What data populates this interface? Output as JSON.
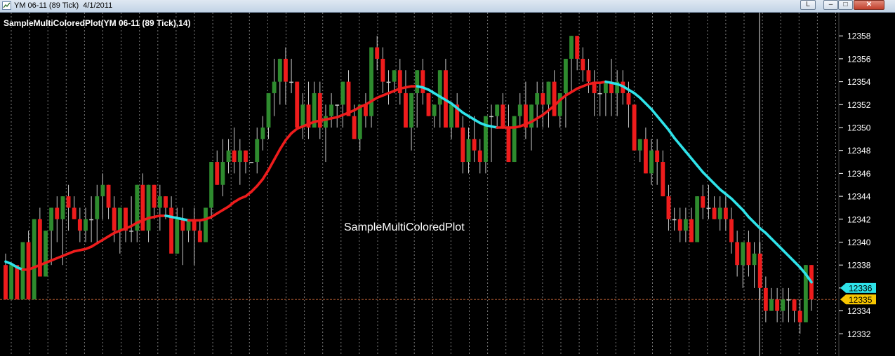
{
  "window": {
    "title": "YM 06-11 (89 Tick)  4/1/2011",
    "lock_label": "L",
    "minimize_label": "–",
    "maximize_label": "□",
    "close_label": "✕"
  },
  "chart_data": {
    "type": "candlestick",
    "instrument": "YM 06-11 (89 Tick)",
    "indicator_label": "SampleMultiColoredPlot(YM 06-11 (89 Tick),14)",
    "watermark": "SampleMultiColoredPlot",
    "y_ticks": [
      12332,
      12334,
      12336,
      12338,
      12340,
      12342,
      12344,
      12346,
      12348,
      12350,
      12352,
      12354,
      12356,
      12358
    ],
    "ylim": [
      12331,
      12359.5
    ],
    "grid": "vertical dotted",
    "last_price": 12335,
    "last_price_label": "12335",
    "indicator_value": 12336,
    "indicator_value_label": "12336",
    "colors": {
      "background": "#000000",
      "up": "#2e8b2e",
      "down": "#ee1c1c",
      "wick": "#c8c8c8",
      "rising_plot": "#ee1c1c",
      "falling_plot": "#2fe3ea",
      "price_marker": "#f7c600",
      "indicator_marker": "#2fe3ea",
      "last_price_line": "#a0522d"
    },
    "bars": [
      [
        12338,
        12339,
        12335,
        12335
      ],
      [
        12335,
        12338,
        12335,
        12338
      ],
      [
        12338,
        12338,
        12335,
        12335
      ],
      [
        12335,
        12340,
        12335,
        12340
      ],
      [
        12340,
        12341,
        12335,
        12335
      ],
      [
        12335,
        12342,
        12335,
        12342
      ],
      [
        12342,
        12343,
        12337,
        12337
      ],
      [
        12337,
        12341,
        12337,
        12341
      ],
      [
        12341,
        12343,
        12338,
        12343
      ],
      [
        12343,
        12344,
        12340,
        12342
      ],
      [
        12342,
        12344,
        12338,
        12344
      ],
      [
        12344,
        12345,
        12341,
        12343
      ],
      [
        12343,
        12344,
        12342,
        12342
      ],
      [
        12342,
        12343,
        12340,
        12341
      ],
      [
        12341,
        12343,
        12340,
        12342
      ],
      [
        12342,
        12344,
        12340,
        12342
      ],
      [
        12342,
        12345,
        12340,
        12344
      ],
      [
        12344,
        12346,
        12342,
        12345
      ],
      [
        12345,
        12345,
        12342,
        12343
      ],
      [
        12343,
        12344,
        12340,
        12341
      ],
      [
        12341,
        12343,
        12339,
        12343
      ],
      [
        12343,
        12343,
        12340,
        12341
      ],
      [
        12341,
        12344,
        12340,
        12341
      ],
      [
        12341,
        12345,
        12340,
        12345
      ],
      [
        12345,
        12346,
        12342,
        12341
      ],
      [
        12341,
        12345,
        12340,
        12345
      ],
      [
        12345,
        12345,
        12342,
        12343
      ],
      [
        12343,
        12345,
        12341,
        12344
      ],
      [
        12344,
        12344,
        12342,
        12343
      ],
      [
        12343,
        12344,
        12340,
        12339
      ],
      [
        12339,
        12343,
        12339,
        12342
      ],
      [
        12342,
        12343,
        12338,
        12341
      ],
      [
        12341,
        12342,
        12340,
        12342
      ],
      [
        12342,
        12343,
        12338,
        12341
      ],
      [
        12341,
        12342,
        12340,
        12340
      ],
      [
        12340,
        12343,
        12340,
        12343
      ],
      [
        12343,
        12347,
        12342,
        12347
      ],
      [
        12347,
        12348,
        12345,
        12345
      ],
      [
        12345,
        12349,
        12344,
        12347
      ],
      [
        12347,
        12349,
        12346,
        12348
      ],
      [
        12348,
        12350,
        12346,
        12347
      ],
      [
        12347,
        12349,
        12345,
        12348
      ],
      [
        12348,
        12348,
        12346,
        12347
      ],
      [
        12347,
        12347,
        12347,
        12347
      ],
      [
        12347,
        12350,
        12346,
        12349
      ],
      [
        12349,
        12351,
        12348,
        12350
      ],
      [
        12350,
        12352,
        12349,
        12353
      ],
      [
        12353,
        12356,
        12351,
        12354
      ],
      [
        12354,
        12356,
        12352,
        12356
      ],
      [
        12356,
        12357,
        12352,
        12354
      ],
      [
        12354,
        12356,
        12353,
        12354
      ],
      [
        12354,
        12354,
        12351,
        12350
      ],
      [
        12350,
        12353,
        12349,
        12352
      ],
      [
        12352,
        12354,
        12349,
        12350
      ],
      [
        12350,
        12354,
        12350,
        12353
      ],
      [
        12353,
        12354,
        12349,
        12350
      ],
      [
        12350,
        12352,
        12347,
        12351
      ],
      [
        12351,
        12353,
        12350,
        12352
      ],
      [
        12352,
        12352,
        12350,
        12352
      ],
      [
        12352,
        12354,
        12350,
        12354
      ],
      [
        12354,
        12355,
        12352,
        12351
      ],
      [
        12351,
        12352,
        12350,
        12349
      ],
      [
        12349,
        12352,
        12348,
        12352
      ],
      [
        12352,
        12353,
        12350,
        12351
      ],
      [
        12351,
        12357,
        12350,
        12357
      ],
      [
        12357,
        12358,
        12355,
        12356
      ],
      [
        12356,
        12357,
        12353,
        12354
      ],
      [
        12354,
        12355,
        12352,
        12354
      ],
      [
        12354,
        12355,
        12353,
        12355
      ],
      [
        12355,
        12356,
        12352,
        12353
      ],
      [
        12353,
        12355,
        12350,
        12350
      ],
      [
        12350,
        12353,
        12348,
        12353
      ],
      [
        12353,
        12355,
        12350,
        12355
      ],
      [
        12355,
        12356,
        12352,
        12353
      ],
      [
        12353,
        12353,
        12351,
        12351
      ],
      [
        12351,
        12352,
        12350,
        12352
      ],
      [
        12352,
        12355,
        12350,
        12355
      ],
      [
        12355,
        12356,
        12350,
        12350
      ],
      [
        12350,
        12352,
        12349,
        12352
      ],
      [
        12352,
        12353,
        12350,
        12350
      ],
      [
        12350,
        12351,
        12346,
        12347
      ],
      [
        12347,
        12350,
        12346,
        12349
      ],
      [
        12349,
        12351,
        12347,
        12348
      ],
      [
        12348,
        12349,
        12346,
        12347
      ],
      [
        12347,
        12350,
        12346,
        12351
      ],
      [
        12351,
        12352,
        12347,
        12351
      ],
      [
        12351,
        12352,
        12350,
        12352
      ],
      [
        12352,
        12353,
        12350,
        12350
      ],
      [
        12350,
        12352,
        12347,
        12347
      ],
      [
        12347,
        12351,
        12347,
        12351
      ],
      [
        12351,
        12353,
        12350,
        12352
      ],
      [
        12352,
        12354,
        12349,
        12350
      ],
      [
        12350,
        12352,
        12348,
        12352
      ],
      [
        12352,
        12354,
        12350,
        12353
      ],
      [
        12353,
        12354,
        12350,
        12352
      ],
      [
        12352,
        12354,
        12350,
        12354
      ],
      [
        12354,
        12355,
        12351,
        12351
      ],
      [
        12351,
        12353,
        12350,
        12353
      ],
      [
        12353,
        12354,
        12350,
        12356
      ],
      [
        12356,
        12358,
        12353,
        12358
      ],
      [
        12358,
        12358,
        12355,
        12356
      ],
      [
        12356,
        12357,
        12354,
        12355
      ],
      [
        12355,
        12356,
        12353,
        12354
      ],
      [
        12354,
        12355,
        12351,
        12353
      ],
      [
        12353,
        12354,
        12351,
        12353
      ],
      [
        12353,
        12354,
        12351,
        12354
      ],
      [
        12354,
        12356,
        12351,
        12353
      ],
      [
        12353,
        12355,
        12351,
        12354
      ],
      [
        12354,
        12355,
        12352,
        12353
      ],
      [
        12353,
        12354,
        12350,
        12352
      ],
      [
        12352,
        12352,
        12348,
        12348
      ],
      [
        12348,
        12349,
        12347,
        12349
      ],
      [
        12349,
        12350,
        12346,
        12346
      ],
      [
        12346,
        12349,
        12345,
        12348
      ],
      [
        12348,
        12349,
        12345,
        12347
      ],
      [
        12347,
        12348,
        12344,
        12344
      ],
      [
        12344,
        12345,
        12341,
        12342
      ],
      [
        12342,
        12343,
        12341,
        12342
      ],
      [
        12342,
        12343,
        12340,
        12341
      ],
      [
        12341,
        12343,
        12340,
        12342
      ],
      [
        12342,
        12343,
        12340,
        12340
      ],
      [
        12340,
        12344,
        12340,
        12344
      ],
      [
        12344,
        12345,
        12342,
        12343
      ],
      [
        12343,
        12345,
        12342,
        12343
      ],
      [
        12343,
        12344,
        12342,
        12342
      ],
      [
        12342,
        12344,
        12341,
        12343
      ],
      [
        12343,
        12344,
        12341,
        12342
      ],
      [
        12342,
        12343,
        12339,
        12340
      ],
      [
        12340,
        12341,
        12337,
        12338
      ],
      [
        12338,
        12339,
        12336,
        12340
      ],
      [
        12340,
        12341,
        12337,
        12338
      ],
      [
        12338,
        12340,
        12336,
        12339
      ],
      [
        12339,
        12340,
        12335,
        12336
      ],
      [
        12336,
        12337,
        12333,
        12334
      ],
      [
        12334,
        12336,
        12334,
        12335
      ],
      [
        12335,
        12336,
        12333,
        12334
      ],
      [
        12334,
        12336,
        12333,
        12335
      ],
      [
        12335,
        12336,
        12333,
        12335
      ],
      [
        12335,
        12335,
        12333,
        12334
      ],
      [
        12334,
        12335,
        12332,
        12333
      ],
      [
        12333,
        12338,
        12333,
        12338
      ],
      [
        12338,
        12338,
        12334,
        12335
      ]
    ],
    "plot": [
      12338.3,
      12338.1,
      12337.8,
      12337.6,
      12337.6,
      12337.8,
      12338.0,
      12338.2,
      12338.4,
      12338.6,
      12338.8,
      12339.0,
      12339.2,
      12339.3,
      12339.4,
      12339.6,
      12339.9,
      12340.2,
      12340.5,
      12340.8,
      12341.0,
      12341.2,
      12341.4,
      12341.7,
      12341.9,
      12342.1,
      12342.2,
      12342.3,
      12342.3,
      12342.2,
      12342.1,
      12342.0,
      12341.9,
      12341.9,
      12341.9,
      12342.0,
      12342.2,
      12342.5,
      12342.8,
      12343.1,
      12343.5,
      12343.8,
      12344.0,
      12344.4,
      12344.9,
      12345.5,
      12346.3,
      12347.2,
      12348.1,
      12348.9,
      12349.5,
      12349.9,
      12350.1,
      12350.3,
      12350.5,
      12350.6,
      12350.7,
      12350.8,
      12350.9,
      12351.1,
      12351.3,
      12351.5,
      12351.8,
      12352.0,
      12352.3,
      12352.6,
      12352.8,
      12353.0,
      12353.2,
      12353.4,
      12353.5,
      12353.6,
      12353.6,
      12353.5,
      12353.3,
      12353.0,
      12352.7,
      12352.4,
      12352.1,
      12351.7,
      12351.3,
      12351.0,
      12350.7,
      12350.4,
      12350.2,
      12350.1,
      12350.0,
      12350.0,
      12350.0,
      12350.0,
      12350.1,
      12350.3,
      12350.5,
      12350.8,
      12351.1,
      12351.5,
      12351.9,
      12352.4,
      12352.8,
      12353.1,
      12353.4,
      12353.6,
      12353.8,
      12353.9,
      12353.9,
      12354.0,
      12353.9,
      12353.8,
      12353.6,
      12353.3,
      12353.0,
      12352.6,
      12352.1,
      12351.6,
      12351.0,
      12350.4,
      12349.8,
      12349.1,
      12348.5,
      12347.9,
      12347.3,
      12346.7,
      12346.1,
      12345.6,
      12345.1,
      12344.6,
      12344.2,
      12343.8,
      12343.3,
      12342.8,
      12342.2,
      12341.7,
      12341.2,
      12340.8,
      12340.3,
      12339.8,
      12339.3,
      12338.8,
      12338.3,
      12337.8,
      12337.2,
      12336.5
    ],
    "plot_color_per_bar": "c",
    "plot_colors_note": ""
  }
}
